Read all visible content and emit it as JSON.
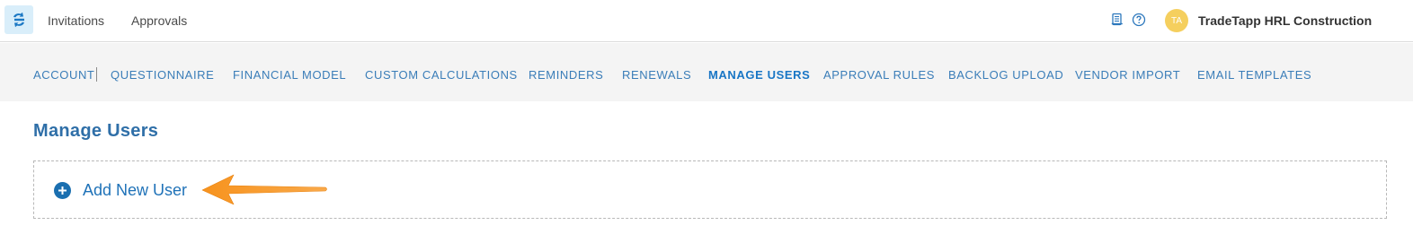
{
  "topbar": {
    "logo_icon": "tradetapp-logo-icon",
    "nav": [
      {
        "label": "Invitations"
      },
      {
        "label": "Approvals"
      }
    ],
    "icons": [
      "document-icon",
      "help-icon"
    ],
    "avatar_initials": "TA",
    "avatar_color": "#f5cf5e",
    "company_name": "TradeTapp HRL Construction"
  },
  "subnav": {
    "items": [
      {
        "label": "ACCOUNT",
        "active": false
      },
      {
        "label": "QUESTIONNAIRE",
        "active": false
      },
      {
        "label": "FINANCIAL MODEL",
        "active": false
      },
      {
        "label": "CUSTOM CALCULATIONS",
        "active": false
      },
      {
        "label": "REMINDERS",
        "active": false
      },
      {
        "label": "RENEWALS",
        "active": false
      },
      {
        "label": "MANAGE USERS",
        "active": true
      },
      {
        "label": "APPROVAL RULES",
        "active": false
      },
      {
        "label": "BACKLOG UPLOAD",
        "active": false
      },
      {
        "label": "VENDOR IMPORT",
        "active": false
      },
      {
        "label": "EMAIL TEMPLATES",
        "active": false
      }
    ]
  },
  "main": {
    "title": "Manage Users",
    "add_user_label": "Add New User",
    "add_icon": "plus-circle-icon",
    "annotation": "orange-arrow-pointer",
    "accent_color": "#1a6fb0",
    "arrow_color": "#f7931e"
  }
}
